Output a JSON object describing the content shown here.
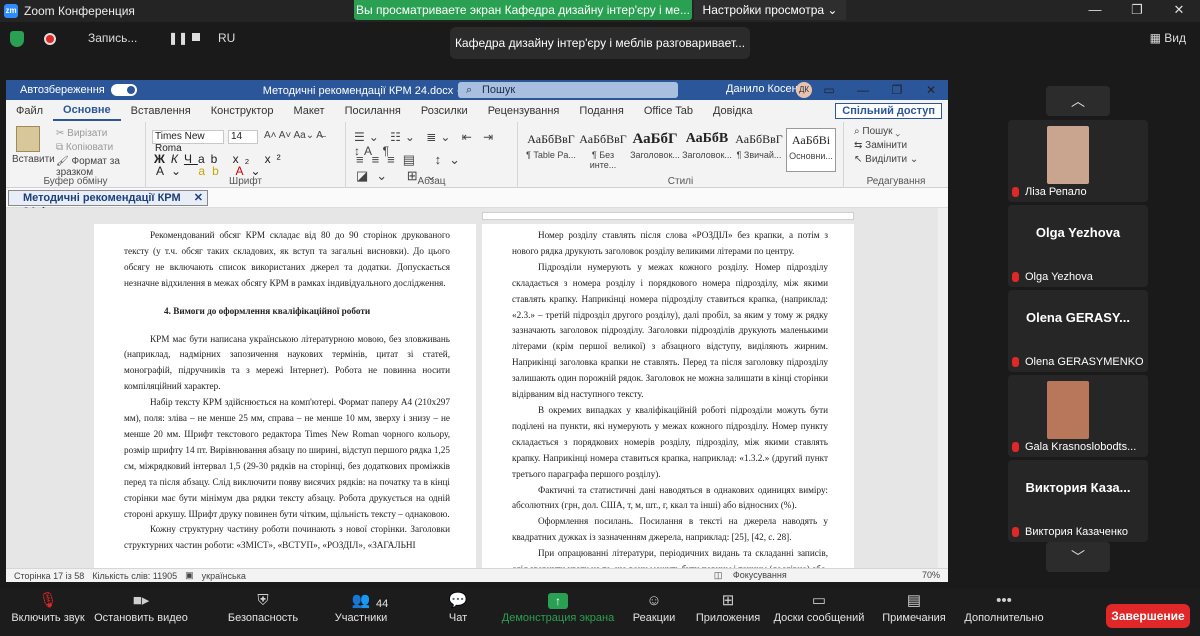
{
  "zoom": {
    "app_title": "Zoom Конференция",
    "logo": "zm",
    "viewing_banner": "Вы просматриваете экран Кафедра дизайну інтер'єру і ме...",
    "view_settings": "Настройки просмотра",
    "recording": "Запись...",
    "pause": "❚❚",
    "lang": "RU",
    "speaker_banner": "Кафедра дизайну інтер'єру і меблів разговаривает...",
    "view_label": "Вид"
  },
  "word": {
    "autosave": "Автозбереження",
    "doc_title": "Методичні рекомендації КРМ 24.docx  ·  Збережено ⌄",
    "search": "Пошук",
    "user": "Данило Косенко",
    "avatar": "ДК",
    "tabs": [
      "Файл",
      "Основне",
      "Вставлення",
      "Конструктор",
      "Макет",
      "Посилання",
      "Розсилки",
      "Рецензування",
      "Подання",
      "Office Tab",
      "Довідка"
    ],
    "share": "Спільний доступ",
    "clipboard": {
      "paste": "Вставити",
      "cut": "Вирізати",
      "copy": "Копіювати",
      "format": "Формат за зразком",
      "label": "Буфер обміну"
    },
    "font": {
      "name": "Times New Roma",
      "size": "14",
      "label": "Шрифт"
    },
    "paragraph_label": "Абзац",
    "styles": [
      {
        "sample": "АаБбВвГ",
        "name": "¶ Table Pa..."
      },
      {
        "sample": "АаБбВвГ",
        "name": "¶ Без инте..."
      },
      {
        "sample": "АаБбГ",
        "name": "Заголовок..."
      },
      {
        "sample": "АаБбВ",
        "name": "Заголовок..."
      },
      {
        "sample": "АаБбВвГ",
        "name": "¶ Звичай..."
      },
      {
        "sample": "АаБбВі",
        "name": "Основни..."
      }
    ],
    "styles_label": "Стилі",
    "editing": {
      "find": "Пошук",
      "replace": "Замінити",
      "select": "Виділити",
      "label": "Редагування"
    },
    "doc_tab": "Методичні рекомендації КРМ 24.docx",
    "status": {
      "page": "Сторінка 17 із 58",
      "words": "Кількість слів: 11905",
      "lang": "українська",
      "focus": "Фокусування",
      "zoom": "70%"
    }
  },
  "page_left": [
    "Рекомендований обсяг КРМ складає від 80 до 90 сторінок друкованого тексту (у т.ч. обсяг таких складових, як вступ та загальні висновки). До цього обсягу не включають список використаних джерел та додатки. Допускається незначне відхилення в межах обсягу КРМ в рамках індивідуального дослідження.",
    "4. Вимоги до оформлення кваліфікаційної роботи",
    "КРМ має бути написана українською літературною мовою, без зловживань (наприклад, надмірних запозичення наукових термінів, цитат зі статей, монографій, підручників та з мережі Інтернет). Робота не повинна носити компіляційний характер.",
    "Набір тексту КРМ здійснюється на комп'ютері. Формат паперу А4 (210х297 мм), поля: зліва – не менше 25 мм, справа – не менше 10 мм, зверху і знизу – не менше 20 мм. Шрифт текстового редактора Times New Roman чорного кольору, розмір шрифту 14 пт. Вирівнювання абзацу по ширині, відступ першого рядка 1,25 см, міжрядковий інтервал 1,5 (29-30 рядків на сторінці, без додаткових проміжків перед та після абзацу. Слід виключити появу висячих рядків: на початку та в кінці сторінки має бути мінімум два рядки тексту абзацу. Робота друкується на одній стороні аркушу. Шрифт друку повинен бути чітким, щільність тексту – однаковою.",
    "Кожну структурну частину роботи починають з нової сторінки. Заголовки структурних частин роботи: «ЗМІСТ», «ВСТУП», «РОЗДІЛ», «ЗАГАЛЬНІ"
  ],
  "page_right": [
    "Номер розділу ставлять після слова «РОЗДІЛ» без крапки, а потім з нового рядка друкують заголовок розділу великими літерами по центру.",
    "Підрозділи нумерують у межах кожного розділу. Номер підрозділу складається з номера розділу і порядкового номера підрозділу, між якими ставлять крапку. Наприкінці номера підрозділу ставиться крапка, (наприклад: «2.3.» – третій підрозділ другого розділу), далі пробіл, за яким у тому ж рядку зазначають заголовок підрозділу. Заголовки підрозділів друкують маленькими літерами (крім першої великої) з абзацного відступу, виділяють жирним. Наприкінці заголовка крапки не ставлять. Перед та після заголовку підрозділу залишають один порожній рядок. Заголовок не можна залишати в кінці сторінки відірваним від наступного тексту.",
    "В окремих випадках у кваліфікаційній роботі підрозділи можуть бути поділені на пункти, які нумерують у межах кожного підрозділу. Номер пункту складається з порядкових номерів розділу, підрозділу, між якими ставлять крапку. Наприкінці номера ставиться крапка, наприклад: «1.3.2.» (другий пункт третього параграфа першого розділу).",
    "Фактичні та статистичні дані наводяться в однакових одиницях виміру: абсолютних (грн, дол. США, т, м, шт., г, ккал та інші) або відносних (%).",
    "Оформлення посилань. Посилання в тексті на джерела наводять у квадратних дужках із зазначенням джерела, наприклад: [25], [42, с. 28].",
    "При опрацюванні літератури, періодичних видань та складанні записів, слід звернути увагу на те, що вони можуть бути повним і точним (дослівно) або"
  ],
  "participants": [
    {
      "name": "",
      "label": "Ліза Репало",
      "photo": true,
      "photo_color": "#c9a58f"
    },
    {
      "name": "Olga Yezhova",
      "label": "Olga Yezhova",
      "photo": false
    },
    {
      "name": "Olena  GERASY...",
      "label": "Olena GERASYMENKO",
      "photo": false
    },
    {
      "name": "",
      "label": "Gala Krasnoslobodts...",
      "photo": true,
      "photo_color": "#b8765a"
    },
    {
      "name": "Виктория  Каза...",
      "label": "Виктория Казаченко",
      "photo": false
    }
  ],
  "toolbar": {
    "mic": "Включить звук",
    "video": "Остановить видео",
    "security": "Безопасность",
    "participants": "Участники",
    "participants_count": "44",
    "chat": "Чат",
    "share": "Демонстрация экрана",
    "reactions": "Реакции",
    "apps": "Приложения",
    "whiteboard": "Доски сообщений",
    "notes": "Примечания",
    "more": "Дополнительно",
    "end": "Завершение"
  },
  "colors": {
    "zoom_green": "#2aa052",
    "word_blue": "#2b579a",
    "end_red": "#e02828"
  }
}
